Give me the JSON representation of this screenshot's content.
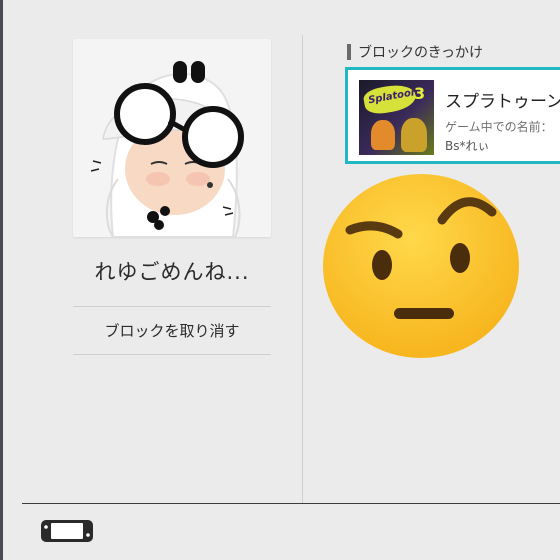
{
  "profile": {
    "username": "れゆごめんね...",
    "unblock_button": "ブロックを取り消す"
  },
  "block_reason": {
    "heading": "ブロックのきっかけ",
    "game": {
      "title": "スプラトゥーン",
      "in_game_name_label": "ゲーム中での名前：",
      "in_game_name": "Bs*れぃ",
      "thumbnail_logo": "Splatoon",
      "thumbnail_number": "3"
    }
  },
  "overlay": {
    "emoji": "raised-eyebrow-face"
  },
  "footer": {
    "icon": "switch-console-icon"
  },
  "colors": {
    "background": "#ebebeb",
    "selection_border": "#21b7c3",
    "emoji_yellow": "#fbc52e"
  }
}
